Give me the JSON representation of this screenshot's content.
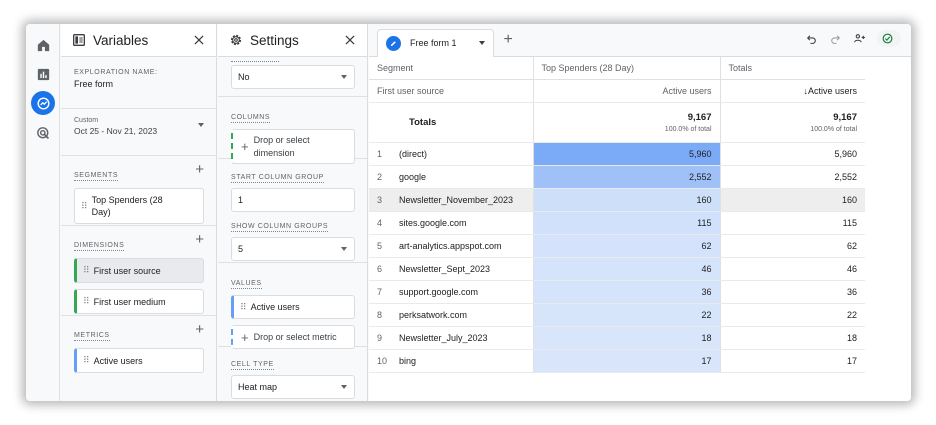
{
  "nav": {
    "items": [
      {
        "name": "home-icon"
      },
      {
        "name": "reports-icon"
      },
      {
        "name": "explore-icon",
        "active": true
      },
      {
        "name": "advertising-icon"
      }
    ]
  },
  "variables": {
    "title": "Variables",
    "exploration_name_label": "EXPLORATION NAME:",
    "exploration_name": "Free form",
    "date_kind": "Custom",
    "date_range": "Oct 25 - Nov 21, 2023",
    "segments_label": "SEGMENTS",
    "segments": [
      "Top Spenders (28 Day)"
    ],
    "dimensions_label": "DIMENSIONS",
    "dimensions": [
      "First user source",
      "First user medium"
    ],
    "metrics_label": "METRICS",
    "metrics": [
      "Active users"
    ]
  },
  "settings": {
    "title": "Settings",
    "top_value": "No",
    "columns_label": "COLUMNS",
    "columns_placeholder": "Drop or select dimension",
    "start_column_group_label": "START COLUMN GROUP",
    "start_column_group": "1",
    "show_column_groups_label": "SHOW COLUMN GROUPS",
    "show_column_groups": "5",
    "values_label": "VALUES",
    "values": [
      "Active users"
    ],
    "values_placeholder": "Drop or select metric",
    "cell_type_label": "CELL TYPE",
    "cell_type": "Heat map"
  },
  "report": {
    "tab_label": "Free form 1",
    "header": {
      "segment": "Segment",
      "segment_col": "Top Spenders (28 Day)",
      "totals_col": "Totals",
      "dimension": "First user source",
      "metric": "Active users",
      "metric_sorted": "Active users",
      "sort_arrow": "↓"
    },
    "totals": {
      "label": "Totals",
      "segment_value": "9,167",
      "segment_pct": "100.0% of total",
      "total_value": "9,167",
      "total_pct": "100.0% of total"
    },
    "rows": [
      {
        "idx": "1",
        "source": "(direct)",
        "seg": "5,960",
        "tot": "5,960",
        "heat": 1.0
      },
      {
        "idx": "2",
        "source": "google",
        "seg": "2,552",
        "tot": "2,552",
        "heat": 0.43
      },
      {
        "idx": "3",
        "source": "Newsletter_November_2023",
        "seg": "160",
        "tot": "160",
        "heat": 0.03
      },
      {
        "idx": "4",
        "source": "sites.google.com",
        "seg": "115",
        "tot": "115",
        "heat": 0.02
      },
      {
        "idx": "5",
        "source": "art-analytics.appspot.com",
        "seg": "62",
        "tot": "62",
        "heat": 0.01
      },
      {
        "idx": "6",
        "source": "Newsletter_Sept_2023",
        "seg": "46",
        "tot": "46",
        "heat": 0.008
      },
      {
        "idx": "7",
        "source": "support.google.com",
        "seg": "36",
        "tot": "36",
        "heat": 0.006
      },
      {
        "idx": "8",
        "source": "perksatwork.com",
        "seg": "22",
        "tot": "22",
        "heat": 0.004
      },
      {
        "idx": "9",
        "source": "Newsletter_July_2023",
        "seg": "18",
        "tot": "18",
        "heat": 0.003
      },
      {
        "idx": "10",
        "source": "bing",
        "seg": "17",
        "tot": "17",
        "heat": 0.003
      }
    ],
    "highlighted_row": 3
  },
  "colors": {
    "accent": "#1a73e8",
    "heat_max": "#7baaf7",
    "heat_low": "#dce8fb",
    "dimension": "#34a853",
    "metric": "#669df6"
  }
}
